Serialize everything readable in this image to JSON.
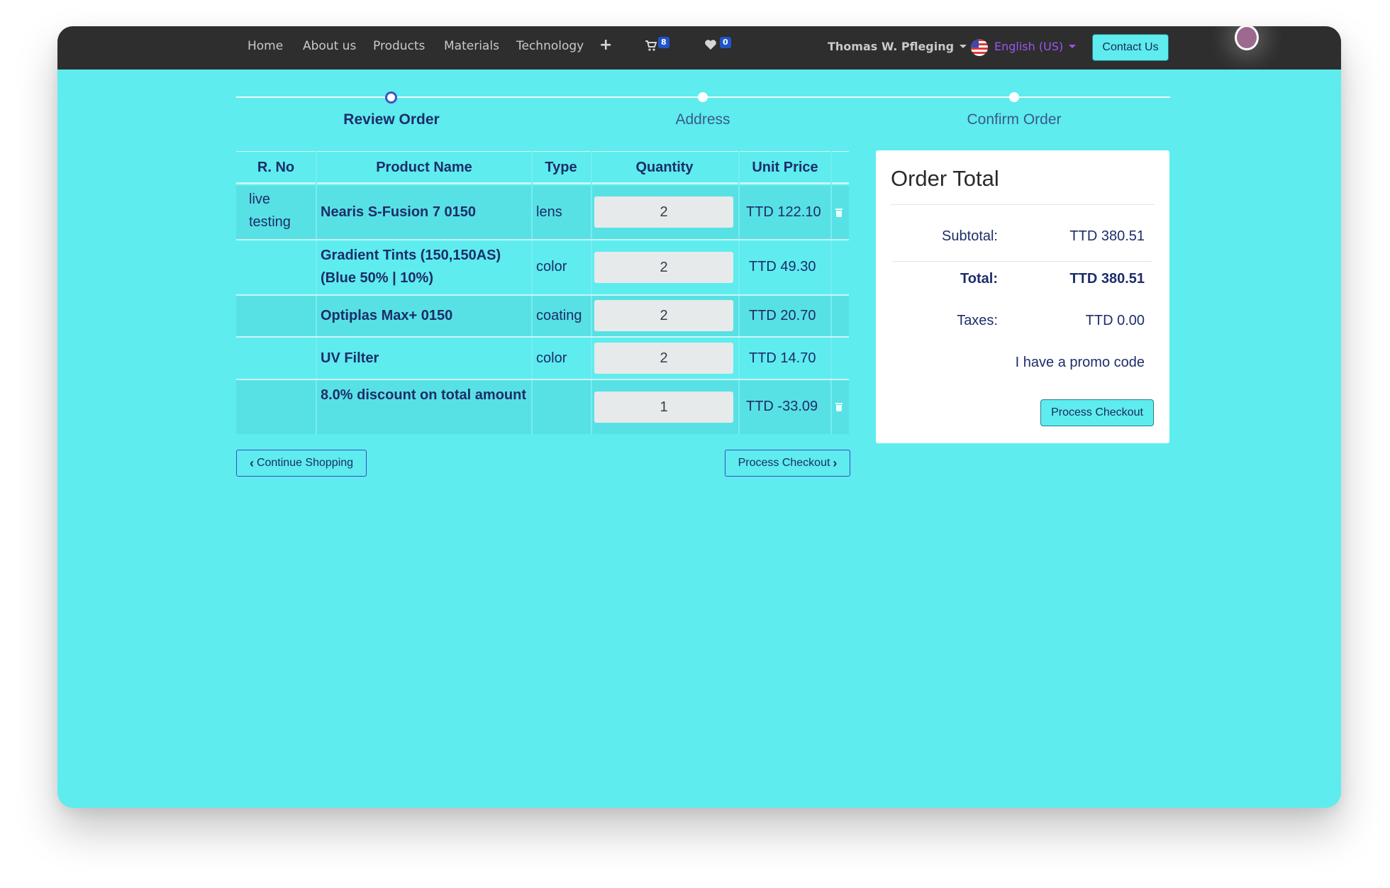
{
  "nav": {
    "links": [
      "Home",
      "About us",
      "Products",
      "Materials",
      "Technology"
    ],
    "plus_icon": "plus-icon",
    "cart_count": "8",
    "wishlist_count": "0",
    "user_name": "Thomas W. Pfleging",
    "language": "English (US)",
    "contact_label": "Contact Us"
  },
  "steps": [
    {
      "label": "Review Order",
      "active": true
    },
    {
      "label": "Address",
      "active": false
    },
    {
      "label": "Confirm Order",
      "active": false
    }
  ],
  "table": {
    "headers": [
      "R. No",
      "Product Name",
      "Type",
      "Quantity",
      "Unit Price"
    ],
    "rows": [
      {
        "rno": "live testing",
        "name": "Nearis S-Fusion 7 0150",
        "type": "lens",
        "qty": "2",
        "price": "TTD 122.10",
        "deletable": true
      },
      {
        "rno": "",
        "name": "Gradient Tints (150,150AS) (Blue 50% | 10%)",
        "type": "color",
        "qty": "2",
        "price": "TTD 49.30",
        "deletable": false
      },
      {
        "rno": "",
        "name": "Optiplas Max+ 0150",
        "type": "coating",
        "qty": "2",
        "price": "TTD 20.70",
        "deletable": false
      },
      {
        "rno": "",
        "name": "UV Filter",
        "type": "color",
        "qty": "2",
        "price": "TTD 14.70",
        "deletable": false
      },
      {
        "rno": "",
        "name": "8.0% discount on total amount",
        "type": "",
        "qty": "1",
        "price": "TTD -33.09",
        "deletable": true
      }
    ]
  },
  "actions": {
    "continue_label": "Continue Shopping",
    "checkout_label": "Process Checkout"
  },
  "order_total": {
    "title": "Order Total",
    "subtotal_label": "Subtotal:",
    "subtotal_value": "TTD 380.51",
    "total_label": "Total:",
    "total_value": "TTD 380.51",
    "taxes_label": "Taxes:",
    "taxes_value": "TTD 0.00",
    "promo_label": "I have a promo code",
    "checkout_label": "Process Checkout"
  },
  "colors": {
    "page_bg": "#5eecee",
    "navbar_bg": "#2e2e2e",
    "text_primary": "#1d2d6a",
    "badge": "#1f55c9",
    "language": "#9b55f0"
  }
}
